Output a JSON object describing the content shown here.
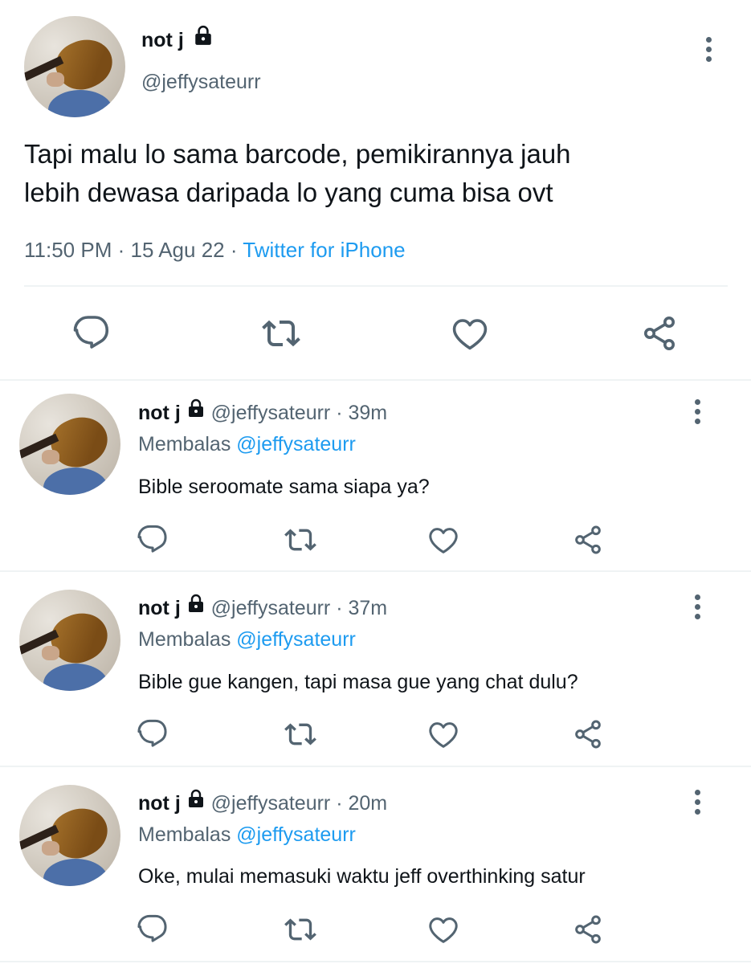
{
  "main_tweet": {
    "author_name": "not j",
    "author_handle": "@jeffysateurr",
    "text_line1": "Tapi malu lo sama barcode, pemikirannya jauh",
    "text_line2": "lebih dewasa daripada lo yang cuma bisa ovt",
    "time": "11:50 PM",
    "date": "15 Agu 22",
    "sep": "·",
    "source": "Twitter for iPhone"
  },
  "replies": [
    {
      "author_name": "not j",
      "author_handle": "@jeffysateurr",
      "age": "· 39m",
      "reply_prefix": "Membalas",
      "reply_to": "@jeffysateurr",
      "text": "Bible seroomate sama siapa ya?"
    },
    {
      "author_name": "not j",
      "author_handle": "@jeffysateurr",
      "age": "· 37m",
      "reply_prefix": "Membalas",
      "reply_to": "@jeffysateurr",
      "text": "Bible gue kangen, tapi masa gue yang chat dulu?"
    },
    {
      "author_name": "not j",
      "author_handle": "@jeffysateurr",
      "age": "· 20m",
      "reply_prefix": "Membalas",
      "reply_to": "@jeffysateurr",
      "text": "Oke, mulai memasuki waktu jeff overthinking satur"
    }
  ],
  "icons": [
    "reply-icon",
    "retweet-icon",
    "like-icon",
    "share-icon",
    "lock-icon",
    "more-icon"
  ],
  "colors": {
    "text": "#0f1419",
    "secondary": "#536471",
    "link": "#1d9bf0",
    "divider": "#eff3f4"
  }
}
